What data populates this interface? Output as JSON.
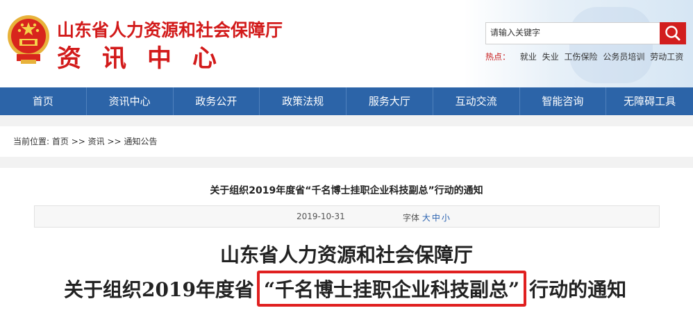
{
  "header": {
    "site_name": "山东省人力资源和社会保障厅",
    "site_sub": "资讯中心",
    "search_placeholder": "请输入关键字",
    "hot_label": "热点：",
    "hot_items": [
      "就业",
      "失业",
      "工伤保险",
      "公务员培训",
      "劳动工资"
    ]
  },
  "nav": [
    "首页",
    "资讯中心",
    "政务公开",
    "政策法规",
    "服务大厅",
    "互动交流",
    "智能咨询",
    "无障碍工具"
  ],
  "breadcrumb": {
    "prefix": "当前位置:",
    "home": "首页",
    "sep": ">>",
    "items": [
      "资讯",
      "通知公告"
    ]
  },
  "article": {
    "title": "关于组织2019年度省“千名博士挂职企业科技副总”行动的通知",
    "date": "2019-10-31",
    "font_label": "字体",
    "font_sizes": [
      "大",
      "中",
      "小"
    ],
    "body_line1": "山东省人力资源和社会保障厅",
    "body_line2_pre": "关于组织2019年度省",
    "body_line2_highlight": "“千名博士挂职企业科技副总”",
    "body_line2_post": "行动的通知"
  },
  "colors": {
    "brand_red": "#d21a1a",
    "nav_blue": "#2c64a8",
    "link_blue": "#2a62b0"
  }
}
